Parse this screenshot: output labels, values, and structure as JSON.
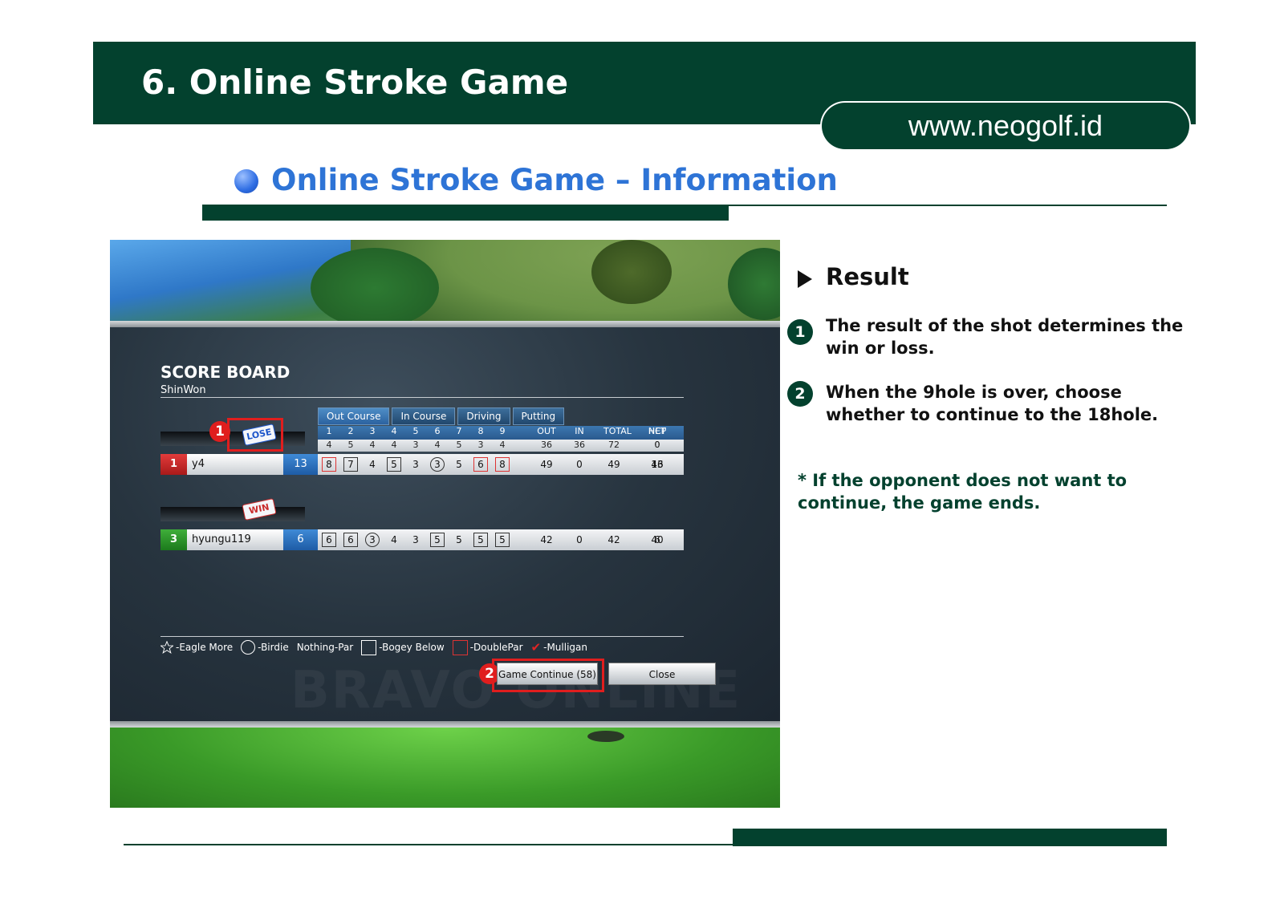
{
  "slide": {
    "title": "6. Online Stroke Game",
    "url": "www.neogolf.id",
    "subtitle": "Online Stroke Game – Information"
  },
  "scoreboard": {
    "title": "SCORE BOARD",
    "user": "ShinWon",
    "tabs": [
      "Out Course",
      "In Course",
      "Driving",
      "Putting"
    ],
    "headers": [
      "1",
      "2",
      "3",
      "4",
      "5",
      "6",
      "7",
      "8",
      "9",
      "OUT",
      "IN",
      "TOTAL",
      "HCP",
      "NET"
    ],
    "par": [
      "4",
      "5",
      "4",
      "4",
      "3",
      "4",
      "5",
      "3",
      "4",
      "36",
      "36",
      "72",
      "0",
      "0"
    ],
    "players": [
      {
        "rank": "1",
        "name": "y4",
        "handicap": "13",
        "tag": "LOSE",
        "holes": [
          "8",
          "7",
          "4",
          "5",
          "3",
          "3",
          "5",
          "6",
          "8"
        ],
        "marks": [
          "dbl",
          "box",
          "",
          "box",
          "",
          "circ",
          "",
          "dbl",
          "dbl"
        ],
        "out": "49",
        "in": "0",
        "total": "49",
        "hcp": "13",
        "net": "46"
      },
      {
        "rank": "3",
        "name": "hyungu119",
        "handicap": "6",
        "tag": "WIN",
        "holes": [
          "6",
          "6",
          "3",
          "4",
          "3",
          "5",
          "5",
          "5",
          "5"
        ],
        "marks": [
          "box",
          "box",
          "circ",
          "",
          "",
          "box",
          "",
          "box",
          "box"
        ],
        "out": "42",
        "in": "0",
        "total": "42",
        "hcp": "6",
        "net": "40"
      }
    ],
    "legend": {
      "eagle": "-Eagle More",
      "birdie": "-Birdie",
      "par": "Nothing-Par",
      "bogey": "-Bogey Below",
      "double": "-DoublePar",
      "mulligan": "-Mulligan"
    },
    "buttons": {
      "continue": "Game Continue (58)",
      "close": "Close"
    },
    "watermark": "BRAVO ONLINE",
    "callouts": [
      "1",
      "2"
    ]
  },
  "info": {
    "heading": "Result",
    "steps": [
      {
        "num": "1",
        "text": "The result of the shot determines the win or loss."
      },
      {
        "num": "2",
        "text": "When the 9hole is over, choose whether to continue to the 18hole."
      }
    ],
    "note": "* If the opponent does not want to continue, the game ends."
  },
  "colors": {
    "brand_green": "#03412e",
    "subtitle_blue": "#2e74d6",
    "highlight_red": "#e01e1e"
  }
}
